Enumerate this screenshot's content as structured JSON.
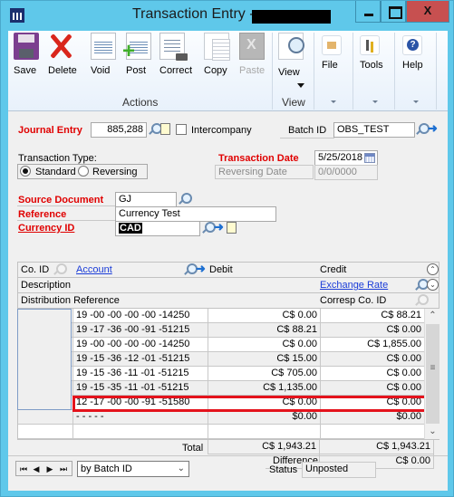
{
  "window": {
    "title": "Transaction Entry  -",
    "close_label": "X"
  },
  "ribbon": {
    "actions": [
      {
        "name": "save",
        "label": "Save",
        "enabled": true
      },
      {
        "name": "delete",
        "label": "Delete",
        "enabled": true
      },
      {
        "name": "void",
        "label": "Void",
        "enabled": true
      },
      {
        "name": "post",
        "label": "Post",
        "enabled": true
      },
      {
        "name": "correct",
        "label": "Correct",
        "enabled": true
      },
      {
        "name": "copy",
        "label": "Copy",
        "enabled": true
      },
      {
        "name": "paste",
        "label": "Paste",
        "enabled": false
      }
    ],
    "actions_group_label": "Actions",
    "view_label": "View",
    "view_group_label": "View",
    "file_label": "File",
    "tools_label": "Tools",
    "help_label": "Help"
  },
  "form": {
    "journal_entry_label": "Journal Entry",
    "journal_entry_value": "885,288",
    "intercompany_label": "Intercompany",
    "intercompany_checked": false,
    "batch_id_label": "Batch ID",
    "batch_id_value": "OBS_TEST",
    "transaction_type_label": "Transaction Type:",
    "type_standard_label": "Standard",
    "type_reversing_label": "Reversing",
    "type_selected": "Standard",
    "transaction_date_label": "Transaction Date",
    "transaction_date_value": "5/25/2018",
    "reversing_date_label": "Reversing Date",
    "reversing_date_value": "0/0/0000",
    "source_document_label": "Source Document",
    "source_document_value": "GJ",
    "reference_label": "Reference",
    "reference_value": "Currency Test",
    "currency_id_label": "Currency ID",
    "currency_id_value": "CAD"
  },
  "grid": {
    "headers": {
      "co_id": "Co. ID",
      "account": "Account",
      "debit": "Debit",
      "credit": "Credit",
      "description": "Description",
      "exchange_rate": "Exchange Rate",
      "distribution_reference": "Distribution Reference",
      "corresp_co_id": "Corresp Co. ID"
    },
    "rows": [
      {
        "account": "19 -00 -00 -00 -00 -14250",
        "debit": "C$ 0.00",
        "credit": "C$ 88.21"
      },
      {
        "account": "19 -17 -36 -00 -91 -51215",
        "debit": "C$ 88.21",
        "credit": "C$ 0.00"
      },
      {
        "account": "19 -00 -00 -00 -00 -14250",
        "debit": "C$ 0.00",
        "credit": "C$ 1,855.00"
      },
      {
        "account": "19 -15 -36 -12 -01 -51215",
        "debit": "C$ 15.00",
        "credit": "C$ 0.00"
      },
      {
        "account": "19 -15 -36 -11 -01 -51215",
        "debit": "C$ 705.00",
        "credit": "C$ 0.00"
      },
      {
        "account": "19 -15 -35 -11 -01 -51215",
        "debit": "C$ 1,135.00",
        "credit": "C$ 0.00"
      },
      {
        "account": "12 -17 -00 -00 -91 -51580",
        "debit": "C$ 0.00",
        "credit": "C$ 0.00"
      },
      {
        "account": "  -   -   -   -   -",
        "debit": "$0.00",
        "credit": "$0.00"
      },
      {
        "account": "",
        "debit": "",
        "credit": ""
      }
    ],
    "highlighted_row_index": 6,
    "total_label": "Total",
    "total_debit": "C$ 1,943.21",
    "total_credit": "C$ 1,943.21",
    "difference_label": "Difference",
    "difference_value": "C$ 0.00"
  },
  "footer": {
    "nav_first": "⏮",
    "nav_prev": "◀",
    "nav_next": "▶",
    "nav_last": "⏭",
    "sort_selected": "by Batch ID",
    "status_label": "Status",
    "status_value": "Unposted"
  },
  "colors": {
    "titlebar": "#5fc8ea",
    "required_label": "#e00000",
    "highlight": "#e4121c",
    "link": "#1a3cd8"
  }
}
